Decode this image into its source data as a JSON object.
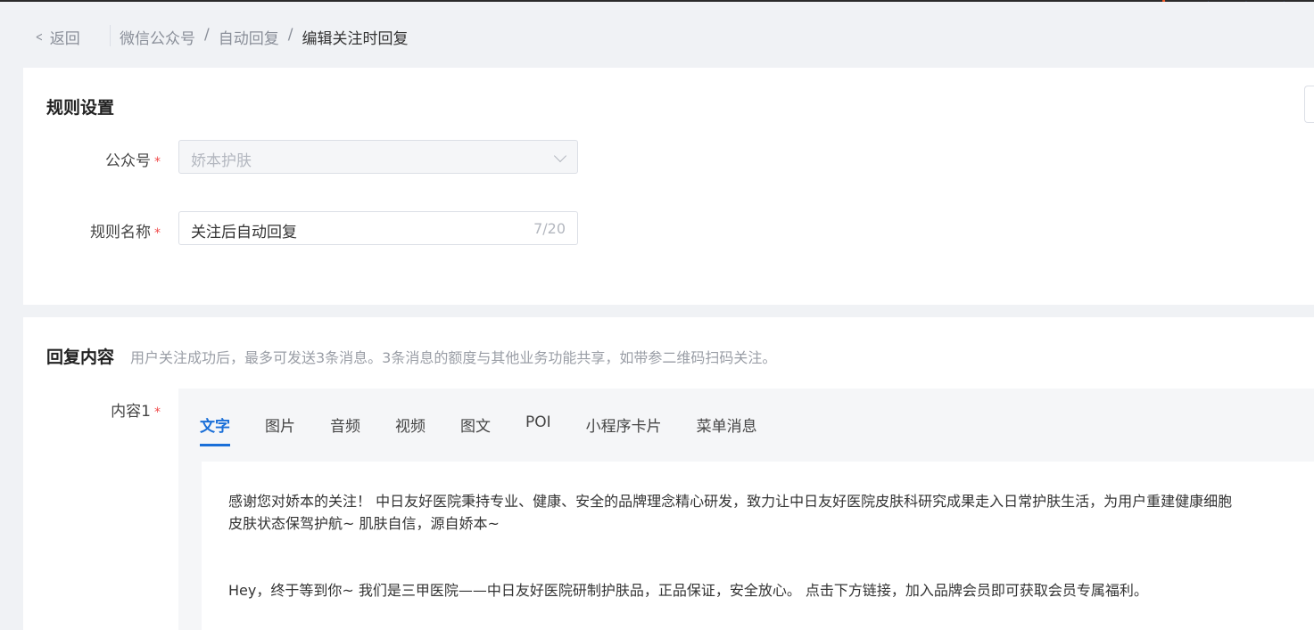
{
  "breadcrumb": {
    "back_label": "返回",
    "items": [
      "微信公众号",
      "自动回复"
    ],
    "current": "编辑关注时回复",
    "separator": "/"
  },
  "rule_settings": {
    "title": "规则设置",
    "account_label": "公众号",
    "account_value": "娇本护肤",
    "rule_name_label": "规则名称",
    "rule_name_value": "关注后自动回复",
    "rule_name_count": "7/20",
    "required_mark": "*"
  },
  "reply_content": {
    "title": "回复内容",
    "hint": "用户关注成功后，最多可发送3条消息。3条消息的额度与其他业务功能共享，如带参二维码扫码关注。",
    "content_label": "内容1",
    "tabs": [
      "文字",
      "图片",
      "音频",
      "视频",
      "图文",
      "POI",
      "小程序卡片",
      "菜单消息"
    ],
    "active_tab": "文字",
    "paragraph1": "感谢您对娇本的关注！ 中日友好医院秉持专业、健康、安全的品牌理念精心研发，致力让中日友好医院皮肤科研究成果走入日常护肤生活，为用户重建健康细胞\n皮肤状态保驾护航~ 肌肤自信，源自娇本~",
    "paragraph2": "Hey，终于等到你~ 我们是三甲医院——中日友好医院研制护肤品，正品保证，安全放心。 点击下方链接，加入品牌会员即可获取会员专属福利。"
  },
  "colors": {
    "accent": "#1a6fd8",
    "required": "#f04b4b",
    "page_bg": "#f0f2f5"
  }
}
